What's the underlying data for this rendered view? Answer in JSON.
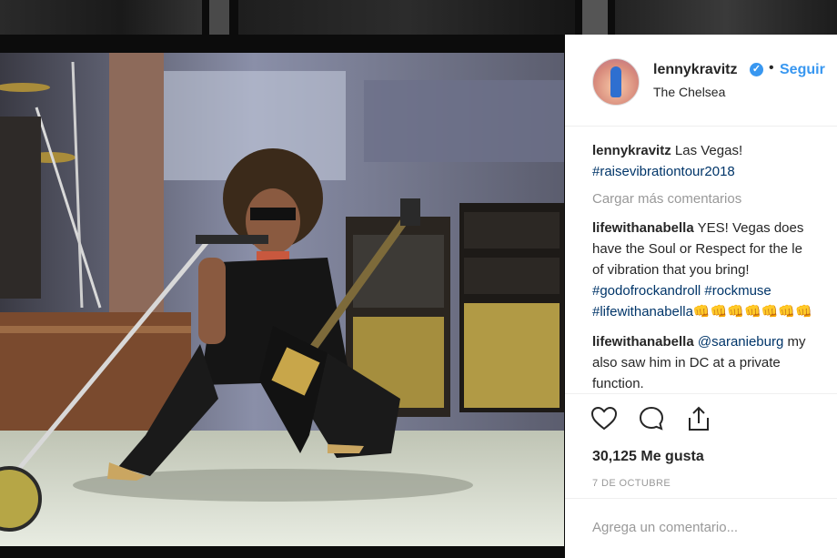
{
  "post": {
    "username": "lennykravitz",
    "follow_label": "Seguir",
    "separator": "•",
    "location": "The Chelsea",
    "icons": {
      "verified": "verified-badge-icon",
      "like": "heart-icon",
      "comment": "comment-bubble-icon",
      "share": "share-icon"
    }
  },
  "caption": {
    "user": "lennykravitz",
    "text": "Las Vegas!",
    "hashtag": "#raisevibrationtour2018"
  },
  "load_more": "Cargar más comentarios",
  "comments": [
    {
      "user": "lifewithanabella",
      "line1": "YES! Vegas does",
      "line2": "have the Soul or Respect for the le",
      "line3": "of vibration that you bring!",
      "tags1": "#godofrockandroll #rockmuse",
      "tags2": "#lifewithanabella",
      "emoji": "👊👊👊👊👊👊👊"
    },
    {
      "user": "lifewithanabella",
      "mention": "@saranieburg",
      "after_mention": "my",
      "line2": "also saw him in DC at a private",
      "line3": "function."
    }
  ],
  "likes": "30,125 Me gusta",
  "date": "7 DE OCTUBRE",
  "add_comment_placeholder": "Agrega un comentario...",
  "colors": {
    "accent": "#3897f0",
    "hashtag": "#003569",
    "muted": "#999999",
    "text": "#262626"
  }
}
